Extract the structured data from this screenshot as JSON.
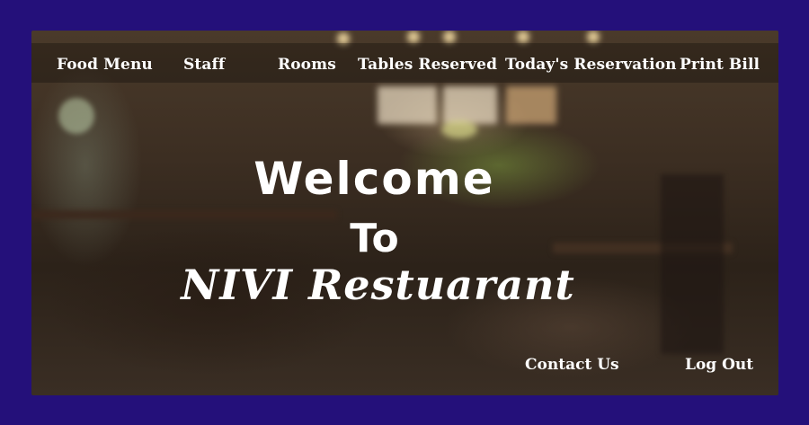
{
  "nav": {
    "items": [
      {
        "label": "Food Menu"
      },
      {
        "label": "Staff"
      },
      {
        "label": "Rooms"
      },
      {
        "label": "Tables Reserved"
      },
      {
        "label": "Today's Reservation"
      },
      {
        "label": "Print Bill"
      }
    ]
  },
  "hero": {
    "line1": "Welcome",
    "line2": "To",
    "line3": "NIVI Restuarant"
  },
  "footer": {
    "contact_label": "Contact Us",
    "logout_label": "Log Out"
  },
  "colors": {
    "page_background": "#24107a",
    "text": "#ffffff"
  }
}
